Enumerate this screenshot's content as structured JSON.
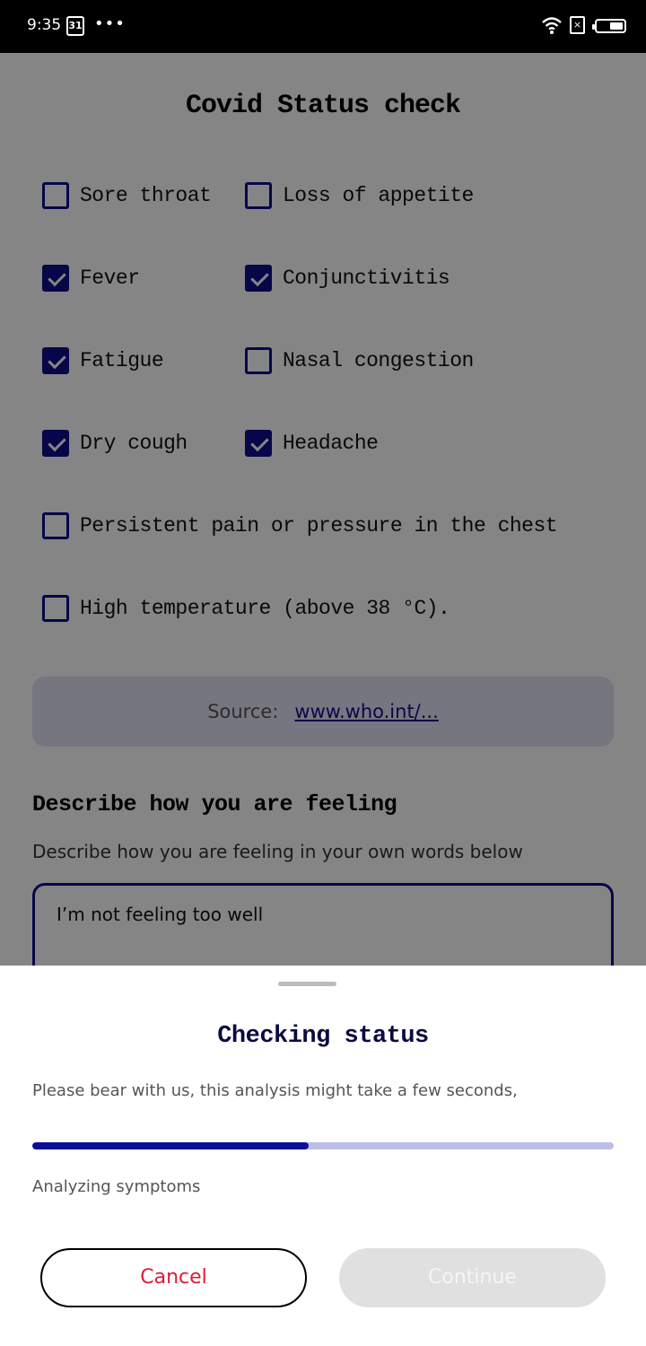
{
  "status_bar": {
    "time": "9:35",
    "calendar_day": "31",
    "dots": "•••",
    "sim_symbol": "×"
  },
  "page": {
    "title": "Covid Status check",
    "symptoms": [
      {
        "label": "Sore throat",
        "checked": false
      },
      {
        "label": "Loss of appetite",
        "checked": false
      },
      {
        "label": "Fever",
        "checked": true
      },
      {
        "label": "Conjunctivitis",
        "checked": true
      },
      {
        "label": "Fatigue",
        "checked": true
      },
      {
        "label": "Nasal congestion",
        "checked": false
      },
      {
        "label": "Dry cough",
        "checked": true
      },
      {
        "label": "Headache",
        "checked": true
      },
      {
        "label": "Persistent pain or pressure in the chest",
        "checked": false
      },
      {
        "label": "High temperature (above 38 °C).",
        "checked": false
      }
    ],
    "source": {
      "label": "Source:",
      "link_text": "www.who.int/..."
    },
    "feeling": {
      "title": "Describe how you are feeling",
      "subtitle": "Describe how you are feeling in your own words below",
      "value": "I’m not feeling too well"
    }
  },
  "sheet": {
    "title": "Checking status",
    "description": "Please bear with us, this analysis might take a few seconds,",
    "progress": 0.475,
    "progress_label": "Analyzing symptoms",
    "cancel_label": "Cancel",
    "continue_label": "Continue"
  },
  "colors": {
    "accent": "#0d0d8c",
    "cancel_text": "#e01a33",
    "progress_track": "#bdbdea"
  }
}
